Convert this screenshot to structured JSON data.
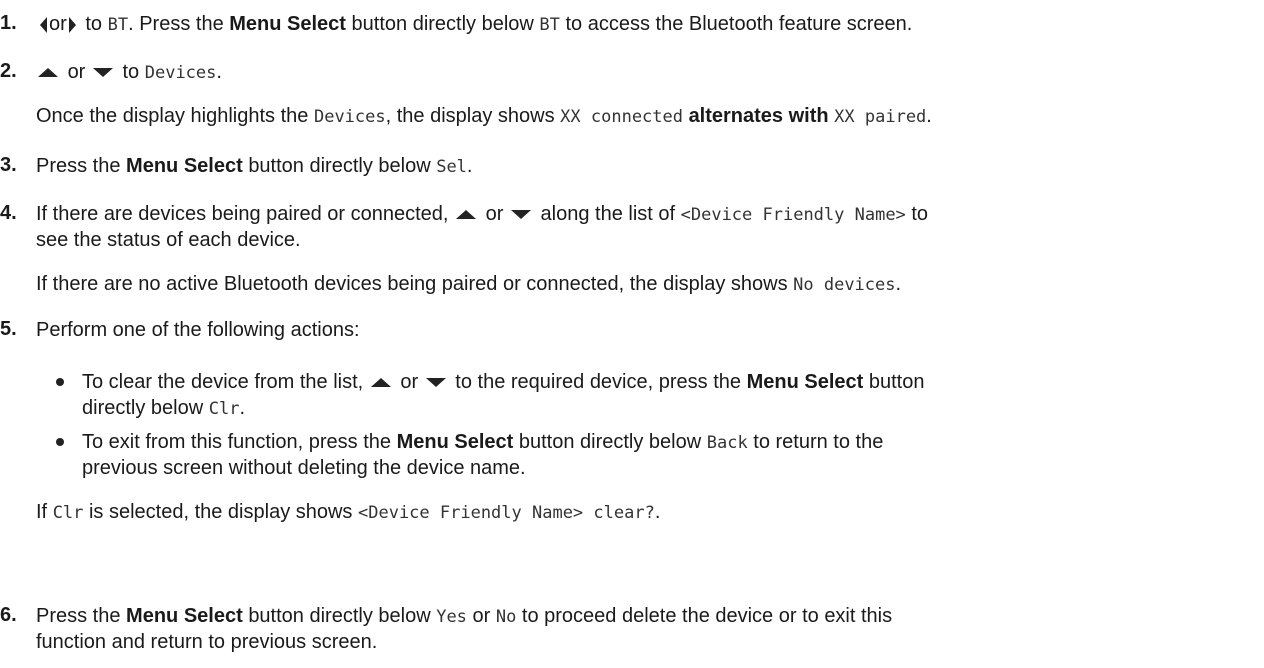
{
  "steps": [
    {
      "num": "1.",
      "s1": "or",
      "s2": "to",
      "m1": "BT",
      "s3": ". Press the",
      "b1": "Menu Select",
      "s4": "button directly below",
      "m2": "BT",
      "s5": "to access the Bluetooth feature screen."
    },
    {
      "num": "2.",
      "s1": "or",
      "s2": "to",
      "m1": "Devices",
      "s3": ".",
      "p_s1": "Once the display highlights the",
      "p_m1": "Devices",
      "p_s2": ", the display shows",
      "p_m2": "XX connected",
      "p_s3": "alternates with",
      "p_m3": "XX paired",
      "p_s4": "."
    },
    {
      "num": "3.",
      "s1": "Press the",
      "b1": "Menu Select",
      "s2": "button directly below",
      "m1": "Sel",
      "s3": "."
    },
    {
      "num": "4.",
      "s1": "If there are devices being paired or connected,",
      "s2": "or",
      "s3": "along the list of",
      "m1": "<Device Friendly Name>",
      "s4": "to",
      "s5": "see the status of each device.",
      "p_s1": "If there are no active Bluetooth devices being paired or connected, the display shows",
      "p_m1": "No devices",
      "p_s2": "."
    },
    {
      "num": "5.",
      "s1": "Perform one of the following actions:",
      "bullets": [
        {
          "s1": "To clear the device from the list,",
          "s2": "or",
          "s3": "to the required device, press the",
          "b1": "Menu Select",
          "s4": "button",
          "s5": "directly below",
          "m1": "Clr",
          "s6": "."
        },
        {
          "s1": "To exit from this function, press the",
          "b1": "Menu Select",
          "s2": "button directly below",
          "m1": "Back",
          "s3": "to return to the",
          "s4": "previous screen without deleting the device name."
        }
      ],
      "p_s1": "If",
      "p_m1": "Clr",
      "p_s2": "is selected, the display shows",
      "p_m2": "<Device Friendly Name> clear?",
      "p_s3": "."
    },
    {
      "num": "6.",
      "s1": "Press the",
      "b1": "Menu Select",
      "s2": "button directly below",
      "m1": "Yes",
      "s3": "or",
      "m2": "No",
      "s4": "to proceed delete the device or to exit this",
      "s5": "function and return to previous screen."
    }
  ]
}
